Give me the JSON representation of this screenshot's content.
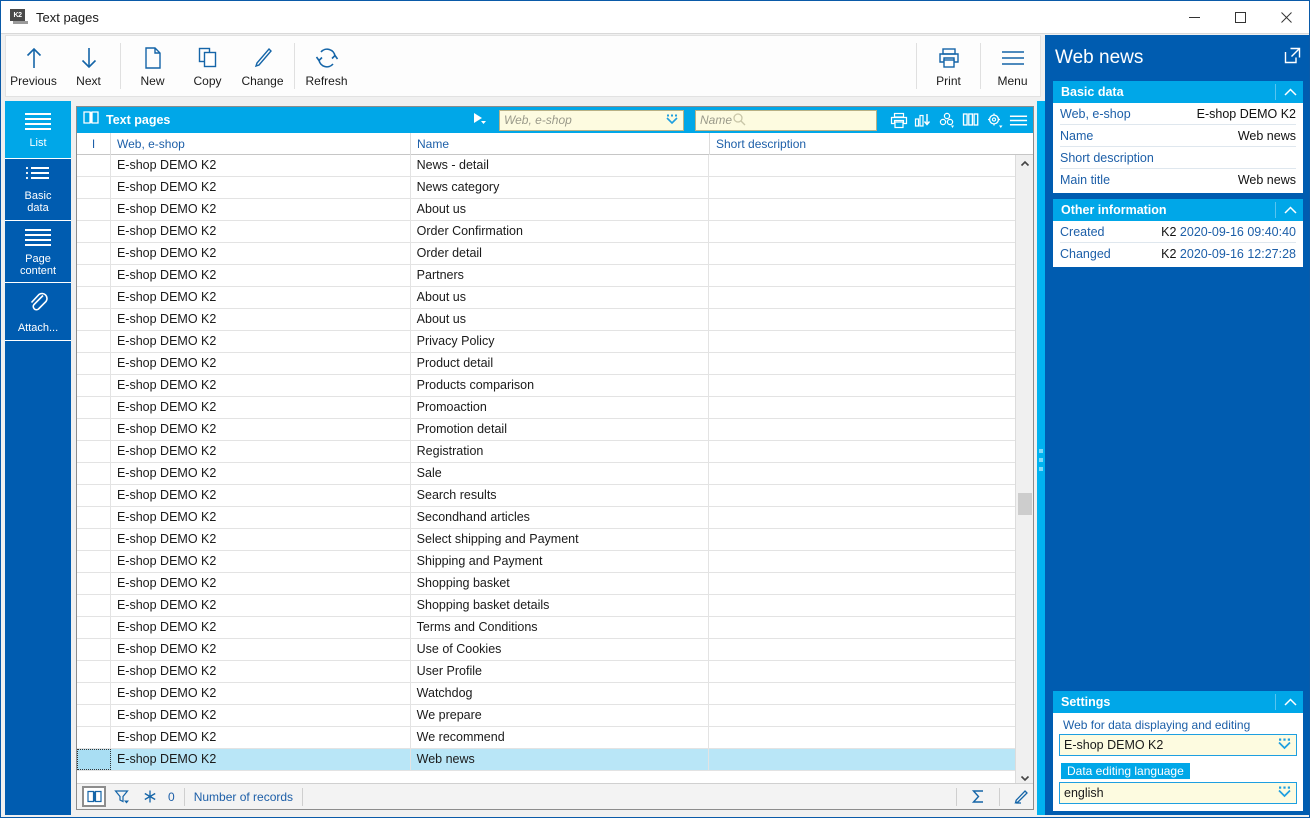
{
  "window": {
    "title": "Text pages",
    "app_icon": "k2-app-icon",
    "minimize": "minimize-icon",
    "maximize": "maximize-icon",
    "close": "close-icon"
  },
  "toolbar": {
    "buttons": [
      {
        "label": "Previous",
        "icon": "arrow-up-icon"
      },
      {
        "label": "Next",
        "icon": "arrow-down-icon"
      },
      {
        "label": "New",
        "icon": "document-icon"
      },
      {
        "label": "Copy",
        "icon": "copy-icon"
      },
      {
        "label": "Change",
        "icon": "pencil-icon"
      },
      {
        "label": "Refresh",
        "icon": "refresh-icon"
      }
    ],
    "right_buttons": [
      {
        "label": "Print",
        "icon": "printer-icon"
      },
      {
        "label": "Menu",
        "icon": "hamburger-icon"
      }
    ]
  },
  "sidebar": {
    "items": [
      {
        "label": "List",
        "icon": "list-lines-icon",
        "active": true
      },
      {
        "label": "Basic\ndata",
        "label_line1": "Basic",
        "label_line2": "data",
        "icon": "bulleted-list-icon",
        "active": false
      },
      {
        "label": "Page\ncontent",
        "label_line1": "Page",
        "label_line2": "content",
        "icon": "lines-icon",
        "active": false
      },
      {
        "label": "Attach...",
        "icon": "paperclip-icon",
        "active": false
      }
    ]
  },
  "grid": {
    "header_title": "Text pages",
    "header_icon": "book-icon",
    "expand_icon": "play-triangle-icon",
    "filter_web": {
      "placeholder": "Web, e-shop",
      "value": ""
    },
    "filter_name": {
      "placeholder": "Name",
      "value": ""
    },
    "header_icons": [
      "printer-icon",
      "bar-chart-icon",
      "cluster-icon",
      "columns-icon",
      "settings-gear-icon",
      "hamburger-icon"
    ],
    "columns": [
      {
        "key": "flag",
        "label": "I"
      },
      {
        "key": "web",
        "label": "Web, e-shop"
      },
      {
        "key": "name",
        "label": "Name"
      },
      {
        "key": "desc",
        "label": "Short description"
      }
    ],
    "rows": [
      {
        "web": "E-shop DEMO K2",
        "name": "News - detail",
        "desc": "",
        "selected": false
      },
      {
        "web": "E-shop DEMO K2",
        "name": "News category",
        "desc": "",
        "selected": false
      },
      {
        "web": "E-shop DEMO K2",
        "name": "About us",
        "desc": "",
        "selected": false
      },
      {
        "web": "E-shop DEMO K2",
        "name": "Order Confirmation",
        "desc": "",
        "selected": false
      },
      {
        "web": "E-shop DEMO K2",
        "name": "Order detail",
        "desc": "",
        "selected": false
      },
      {
        "web": "E-shop DEMO K2",
        "name": "Partners",
        "desc": "",
        "selected": false
      },
      {
        "web": "E-shop DEMO K2",
        "name": "About us",
        "desc": "",
        "selected": false
      },
      {
        "web": "E-shop DEMO K2",
        "name": "About us",
        "desc": "",
        "selected": false
      },
      {
        "web": "E-shop DEMO K2",
        "name": "Privacy Policy",
        "desc": "",
        "selected": false
      },
      {
        "web": "E-shop DEMO K2",
        "name": "Product detail",
        "desc": "",
        "selected": false
      },
      {
        "web": "E-shop DEMO K2",
        "name": "Products comparison",
        "desc": "",
        "selected": false
      },
      {
        "web": "E-shop DEMO K2",
        "name": "Promoaction",
        "desc": "",
        "selected": false
      },
      {
        "web": "E-shop DEMO K2",
        "name": "Promotion detail",
        "desc": "",
        "selected": false
      },
      {
        "web": "E-shop DEMO K2",
        "name": "Registration",
        "desc": "",
        "selected": false
      },
      {
        "web": "E-shop DEMO K2",
        "name": "Sale",
        "desc": "",
        "selected": false
      },
      {
        "web": "E-shop DEMO K2",
        "name": "Search results",
        "desc": "",
        "selected": false
      },
      {
        "web": "E-shop DEMO K2",
        "name": "Secondhand articles",
        "desc": "",
        "selected": false
      },
      {
        "web": "E-shop DEMO K2",
        "name": "Select shipping and Payment",
        "desc": "",
        "selected": false
      },
      {
        "web": "E-shop DEMO K2",
        "name": "Shipping and Payment",
        "desc": "",
        "selected": false
      },
      {
        "web": "E-shop DEMO K2",
        "name": "Shopping basket",
        "desc": "",
        "selected": false
      },
      {
        "web": "E-shop DEMO K2",
        "name": "Shopping basket details",
        "desc": "",
        "selected": false
      },
      {
        "web": "E-shop DEMO K2",
        "name": "Terms and Conditions",
        "desc": "",
        "selected": false
      },
      {
        "web": "E-shop DEMO K2",
        "name": "Use of Cookies",
        "desc": "",
        "selected": false
      },
      {
        "web": "E-shop DEMO K2",
        "name": "User Profile",
        "desc": "",
        "selected": false
      },
      {
        "web": "E-shop DEMO K2",
        "name": "Watchdog",
        "desc": "",
        "selected": false
      },
      {
        "web": "E-shop DEMO K2",
        "name": "We prepare",
        "desc": "",
        "selected": false
      },
      {
        "web": "E-shop DEMO K2",
        "name": "We recommend",
        "desc": "",
        "selected": false
      },
      {
        "web": "E-shop DEMO K2",
        "name": "Web news",
        "desc": "",
        "selected": true
      }
    ]
  },
  "statusbar": {
    "book_icon": "book-icon",
    "filter_icon": "funnel-icon",
    "snowflake_icon": "snowflake-icon",
    "count": "0",
    "records_label": "Number of records",
    "sum_icon": "sigma-icon",
    "edit_icon": "pencil-icon"
  },
  "details": {
    "title": "Web news",
    "popout_icon": "popout-icon",
    "sections": [
      {
        "title": "Basic data",
        "collapse_icon": "chevron-up-icon",
        "rows": [
          {
            "label": "Web, e-shop",
            "value": "E-shop DEMO K2"
          },
          {
            "label": "Name",
            "value": "Web news"
          },
          {
            "label": "Short description",
            "value": ""
          },
          {
            "label": "Main title",
            "value": "Web news"
          }
        ]
      },
      {
        "title": "Other information",
        "collapse_icon": "chevron-up-icon",
        "rows": [
          {
            "label": "Created",
            "value": "K2 2020-09-16 09:40:40"
          },
          {
            "label": "Changed",
            "value": "K2 2020-09-16 12:27:28"
          }
        ]
      }
    ]
  },
  "settings": {
    "title": "Settings",
    "collapse_icon": "chevron-up-icon",
    "web_label": "Web for data displaying and editing",
    "web_value": "E-shop DEMO K2",
    "lang_label": "Data editing language",
    "lang_value": "english",
    "dropdown_icon": "dropdown-icon"
  },
  "colors": {
    "accent_dark": "#005cb0",
    "accent_light": "#00a7e8",
    "selection": "#b9e6f7",
    "field_bg": "#fdfbe0",
    "link_text": "#1d5fa8"
  }
}
